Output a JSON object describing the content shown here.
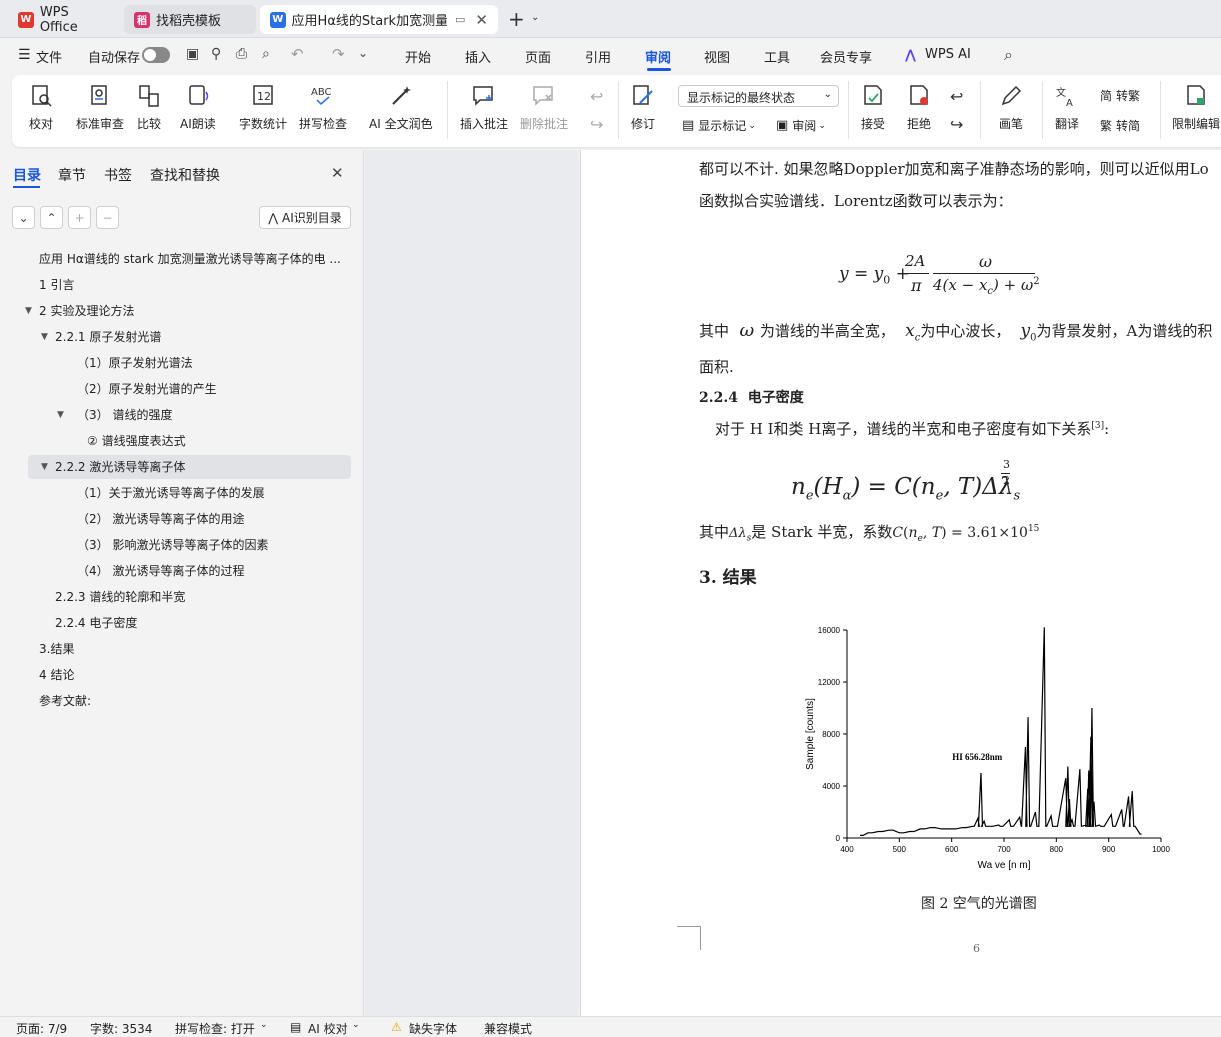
{
  "tabs": [
    {
      "label": "WPS Office"
    },
    {
      "label": "找稻壳模板"
    },
    {
      "label": "应用Hα线的Stark加宽测量激"
    }
  ],
  "menu": {
    "file": "文件",
    "autosave": "自动保存",
    "items": [
      "开始",
      "插入",
      "页面",
      "引用",
      "审阅",
      "视图",
      "工具",
      "会员专享",
      "WPS AI"
    ]
  },
  "ribbon": {
    "items": [
      "校对",
      "标准审查",
      "比较",
      "AI朗读",
      "字数统计",
      "拼写检查",
      "AI 全文润色",
      "插入批注",
      "删除批注",
      "修订",
      "显示标记",
      "审阅",
      "接受",
      "拒绝",
      "画笔",
      "翻译",
      "转繁",
      "转简",
      "限制编辑"
    ],
    "markup_select": "显示标记的最终状态"
  },
  "sidebar": {
    "tabs": [
      "目录",
      "章节",
      "书签",
      "查找和替换"
    ],
    "ai_button": "AI识别目录",
    "toc": [
      "应用 Hα谱线的 stark 加宽测量激光诱导等离子体的电 ...",
      "1 引言",
      "2 实验及理论方法",
      "2.2.1 原子发射光谱",
      "（1）原子发射光谱法",
      "（2）原子发射光谱的产生",
      "（3）   谱线的强度",
      "② 谱线强度表达式",
      "2.2.2  激光诱导等离子体",
      "（1）关于激光诱导等离子体的发展",
      "（2）   激光诱导等离子体的用途",
      "（3）   影响激光诱导等离子体的因素",
      "（4）   激光诱导等离子体的过程",
      "2.2.3  谱线的轮廓和半宽",
      "2.2.4  电子密度",
      "3.结果",
      "4  结论",
      "参考文献:"
    ]
  },
  "document": {
    "p1": "都可以不计. 如果忽略Doppler加宽和离子准静态场的影响，则可以近似用Lo",
    "p2": "函数拟合实验谱线．Lorentz函数可以表示为：",
    "p3a": "其中",
    "p3b": "为谱线的半高全宽，",
    "p3c": "为中心波长，",
    "p3d": "为背景发射，A为谱线的积",
    "p4": "面积.",
    "heading_num": "2.2.4",
    "heading": "电子密度",
    "p5": "对于 H I和类 H离子，谱线的半宽和电子密度有如下关系",
    "cite": "[3]",
    "p6a": "其中",
    "p6b": "是 Stark 半宽，系数",
    "p6c": "= 3.61×10",
    "p6d": "15",
    "section": "3. 结果",
    "caption": "图 2 空气的光谱图",
    "page_number": "6"
  },
  "chart_data": {
    "type": "line",
    "xlabel": "Wa ve [n m]",
    "ylabel": "Sample [counts]",
    "xlim": [
      400,
      1000
    ],
    "ylim": [
      0,
      16000
    ],
    "xticks": [
      400,
      500,
      600,
      700,
      800,
      900,
      1000
    ],
    "yticks": [
      0,
      4000,
      8000,
      12000,
      16000
    ],
    "annotation": "HI 656.28nm",
    "series": [
      {
        "x": [
          425,
          440,
          460,
          480,
          500,
          520,
          540,
          560,
          580,
          600,
          620,
          640,
          650,
          656,
          662,
          670,
          690,
          710,
          730,
          741,
          746,
          760,
          777,
          790,
          818,
          822,
          825,
          830,
          845,
          856,
          860,
          862,
          866,
          868,
          872,
          882,
          905,
          925,
          938,
          945,
          960
        ],
        "y": [
          200,
          400,
          500,
          600,
          400,
          500,
          700,
          800,
          700,
          700,
          800,
          900,
          1500,
          5000,
          1300,
          900,
          1000,
          1400,
          1600,
          7000,
          9300,
          2000,
          16200,
          1700,
          4600,
          5500,
          3000,
          1400,
          5300,
          1000,
          3800,
          5200,
          7800,
          10000,
          2800,
          1000,
          1800,
          2200,
          3200,
          3600,
          300
        ]
      }
    ]
  },
  "statusbar": {
    "page": "页面: 7/9",
    "words": "字数: 3534",
    "spell": "拼写检查: 打开",
    "ai": "AI 校对",
    "font": "缺失字体",
    "mode": "兼容模式"
  }
}
